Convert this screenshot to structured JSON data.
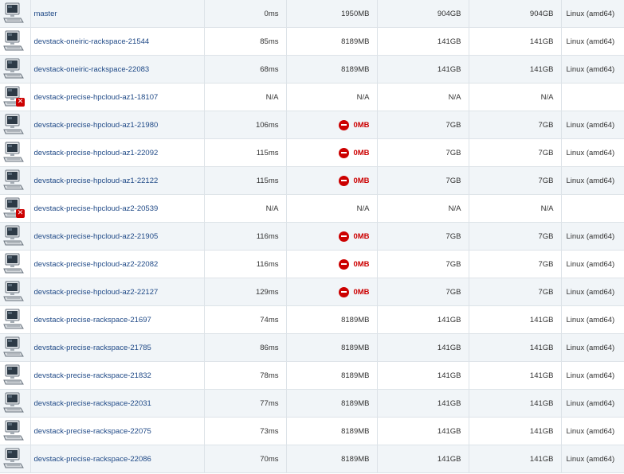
{
  "nodes": [
    {
      "name": "master",
      "response": "0ms",
      "memory": "1950MB",
      "memory_warning": false,
      "disk": "904GB",
      "tmp": "904GB",
      "arch": "Linux (amd64)",
      "offline": false
    },
    {
      "name": "devstack-oneiric-rackspace-21544",
      "response": "85ms",
      "memory": "8189MB",
      "memory_warning": false,
      "disk": "141GB",
      "tmp": "141GB",
      "arch": "Linux (amd64)",
      "offline": false
    },
    {
      "name": "devstack-oneiric-rackspace-22083",
      "response": "68ms",
      "memory": "8189MB",
      "memory_warning": false,
      "disk": "141GB",
      "tmp": "141GB",
      "arch": "Linux (amd64)",
      "offline": false
    },
    {
      "name": "devstack-precise-hpcloud-az1-18107",
      "response": "N/A",
      "memory": "N/A",
      "memory_warning": false,
      "disk": "N/A",
      "tmp": "N/A",
      "arch": "",
      "offline": true
    },
    {
      "name": "devstack-precise-hpcloud-az1-21980",
      "response": "106ms",
      "memory": "0MB",
      "memory_warning": true,
      "disk": "7GB",
      "tmp": "7GB",
      "arch": "Linux (amd64)",
      "offline": false
    },
    {
      "name": "devstack-precise-hpcloud-az1-22092",
      "response": "115ms",
      "memory": "0MB",
      "memory_warning": true,
      "disk": "7GB",
      "tmp": "7GB",
      "arch": "Linux (amd64)",
      "offline": false
    },
    {
      "name": "devstack-precise-hpcloud-az1-22122",
      "response": "115ms",
      "memory": "0MB",
      "memory_warning": true,
      "disk": "7GB",
      "tmp": "7GB",
      "arch": "Linux (amd64)",
      "offline": false
    },
    {
      "name": "devstack-precise-hpcloud-az2-20539",
      "response": "N/A",
      "memory": "N/A",
      "memory_warning": false,
      "disk": "N/A",
      "tmp": "N/A",
      "arch": "",
      "offline": true
    },
    {
      "name": "devstack-precise-hpcloud-az2-21905",
      "response": "116ms",
      "memory": "0MB",
      "memory_warning": true,
      "disk": "7GB",
      "tmp": "7GB",
      "arch": "Linux (amd64)",
      "offline": false
    },
    {
      "name": "devstack-precise-hpcloud-az2-22082",
      "response": "116ms",
      "memory": "0MB",
      "memory_warning": true,
      "disk": "7GB",
      "tmp": "7GB",
      "arch": "Linux (amd64)",
      "offline": false
    },
    {
      "name": "devstack-precise-hpcloud-az2-22127",
      "response": "129ms",
      "memory": "0MB",
      "memory_warning": true,
      "disk": "7GB",
      "tmp": "7GB",
      "arch": "Linux (amd64)",
      "offline": false
    },
    {
      "name": "devstack-precise-rackspace-21697",
      "response": "74ms",
      "memory": "8189MB",
      "memory_warning": false,
      "disk": "141GB",
      "tmp": "141GB",
      "arch": "Linux (amd64)",
      "offline": false
    },
    {
      "name": "devstack-precise-rackspace-21785",
      "response": "86ms",
      "memory": "8189MB",
      "memory_warning": false,
      "disk": "141GB",
      "tmp": "141GB",
      "arch": "Linux (amd64)",
      "offline": false
    },
    {
      "name": "devstack-precise-rackspace-21832",
      "response": "78ms",
      "memory": "8189MB",
      "memory_warning": false,
      "disk": "141GB",
      "tmp": "141GB",
      "arch": "Linux (amd64)",
      "offline": false
    },
    {
      "name": "devstack-precise-rackspace-22031",
      "response": "77ms",
      "memory": "8189MB",
      "memory_warning": false,
      "disk": "141GB",
      "tmp": "141GB",
      "arch": "Linux (amd64)",
      "offline": false
    },
    {
      "name": "devstack-precise-rackspace-22075",
      "response": "73ms",
      "memory": "8189MB",
      "memory_warning": false,
      "disk": "141GB",
      "tmp": "141GB",
      "arch": "Linux (amd64)",
      "offline": false
    },
    {
      "name": "devstack-precise-rackspace-22086",
      "response": "70ms",
      "memory": "8189MB",
      "memory_warning": false,
      "disk": "141GB",
      "tmp": "141GB",
      "arch": "Linux (amd64)",
      "offline": false
    }
  ],
  "icons": {
    "computer": "computer-icon",
    "offline_badge": "offline-x-icon",
    "memory_warning": "no-entry-icon"
  },
  "colors": {
    "link": "#204a87",
    "alt_row": "#f1f5f8",
    "warning": "#cc0000",
    "border": "#dde3e8"
  }
}
